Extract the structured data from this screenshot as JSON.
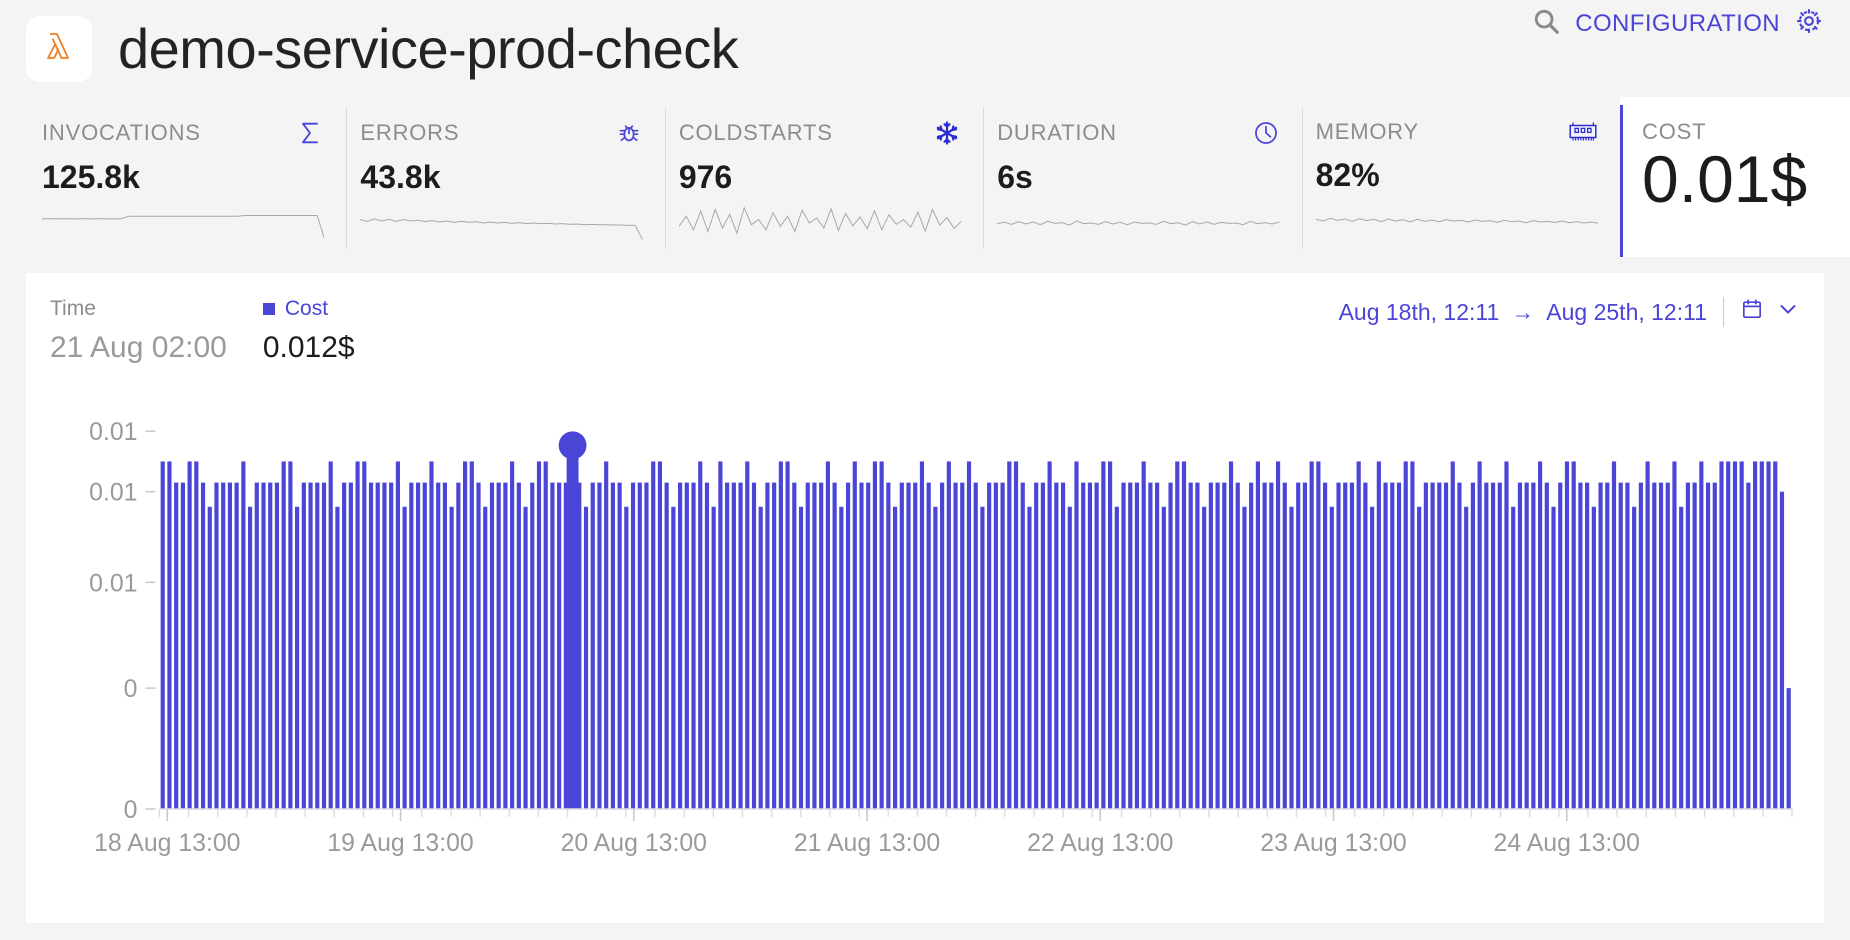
{
  "header": {
    "logo_icon": "aws-lambda-icon",
    "title": "demo-service-prod-check",
    "search_icon": "search-icon",
    "configuration_label": "CONFIGURATION",
    "gear_icon": "gear-icon",
    "accent_color": "#4a45d6",
    "logo_color": "#ef7d22"
  },
  "metrics": [
    {
      "label": "INVOCATIONS",
      "value": "125.8k",
      "icon": "sigma-icon"
    },
    {
      "label": "ERRORS",
      "value": "43.8k",
      "icon": "bug-icon"
    },
    {
      "label": "COLDSTARTS",
      "value": "976",
      "icon": "snowflake-icon"
    },
    {
      "label": "DURATION",
      "value": "6s",
      "icon": "clock-icon"
    },
    {
      "label": "MEMORY",
      "value": "82%",
      "icon": "memory-chip-icon"
    },
    {
      "label": "COST",
      "value": "0.01$",
      "icon": "",
      "selected": true
    }
  ],
  "chart_panel": {
    "tooltip": {
      "time_label": "Time",
      "time_value": "21 Aug 02:00",
      "series_label": "Cost",
      "series_value": "0.012$"
    },
    "date_range": {
      "start": "Aug 18th, 12:11",
      "arrow": "→",
      "end": "Aug 25th, 12:11",
      "calendar_icon": "calendar-icon",
      "chevron_icon": "chevron-down-icon"
    }
  },
  "chart_data": {
    "type": "bar",
    "title": "",
    "xlabel": "",
    "ylabel": "",
    "series_name": "Cost",
    "series_color": "#4a45d6",
    "grid": false,
    "legend_position": "top-left",
    "ytick_labels": [
      "0.01",
      "0.01",
      "0.01",
      "0",
      "0"
    ],
    "ytick_values": [
      0.0125,
      0.0105,
      0.0075,
      0.004,
      0.0
    ],
    "ylim": [
      0,
      0.0135
    ],
    "xtick_labels": [
      "18 Aug 13:00",
      "19 Aug 13:00",
      "20 Aug 13:00",
      "21 Aug 13:00",
      "22 Aug 13:00",
      "23 Aug 13:00",
      "24 Aug 13:00"
    ],
    "xlim_start": "Aug 18th, 12:11",
    "xlim_end": "Aug 25th, 12:11",
    "highlighted": {
      "x_label": "21 Aug 02:00",
      "value": 0.012,
      "index": 61
    },
    "values": [
      0.0115,
      0.0115,
      0.0108,
      0.0108,
      0.0115,
      0.0115,
      0.0108,
      0.01,
      0.0108,
      0.0108,
      0.0108,
      0.0108,
      0.0115,
      0.01,
      0.0108,
      0.0108,
      0.0108,
      0.0108,
      0.0115,
      0.0115,
      0.01,
      0.0108,
      0.0108,
      0.0108,
      0.0108,
      0.0115,
      0.01,
      0.0108,
      0.0108,
      0.0115,
      0.0115,
      0.0108,
      0.0108,
      0.0108,
      0.0108,
      0.0115,
      0.01,
      0.0108,
      0.0108,
      0.0108,
      0.0115,
      0.0108,
      0.0108,
      0.01,
      0.0108,
      0.0115,
      0.0115,
      0.0108,
      0.01,
      0.0108,
      0.0108,
      0.0108,
      0.0115,
      0.0108,
      0.01,
      0.0108,
      0.0115,
      0.0115,
      0.0108,
      0.0108,
      0.0108,
      0.012,
      0.0108,
      0.01,
      0.0108,
      0.0108,
      0.0115,
      0.0108,
      0.0108,
      0.01,
      0.0108,
      0.0108,
      0.0108,
      0.0115,
      0.0115,
      0.0108,
      0.01,
      0.0108,
      0.0108,
      0.0108,
      0.0115,
      0.0108,
      0.01,
      0.0115,
      0.0108,
      0.0108,
      0.0108,
      0.0115,
      0.0108,
      0.01,
      0.0108,
      0.0108,
      0.0115,
      0.0115,
      0.0108,
      0.01,
      0.0108,
      0.0108,
      0.0108,
      0.0115,
      0.0108,
      0.01,
      0.0108,
      0.0115,
      0.0108,
      0.0108,
      0.0115,
      0.0115,
      0.0108,
      0.01,
      0.0108,
      0.0108,
      0.0108,
      0.0115,
      0.0108,
      0.01,
      0.0108,
      0.0115,
      0.0108,
      0.0108,
      0.0115,
      0.0108,
      0.01,
      0.0108,
      0.0108,
      0.0108,
      0.0115,
      0.0115,
      0.0108,
      0.01,
      0.0108,
      0.0108,
      0.0115,
      0.0108,
      0.0108,
      0.01,
      0.0115,
      0.0108,
      0.0108,
      0.0108,
      0.0115,
      0.0115,
      0.01,
      0.0108,
      0.0108,
      0.0108,
      0.0115,
      0.0108,
      0.0108,
      0.01,
      0.0108,
      0.0115,
      0.0115,
      0.0108,
      0.0108,
      0.01,
      0.0108,
      0.0108,
      0.0108,
      0.0115,
      0.0108,
      0.01,
      0.0108,
      0.0115,
      0.0108,
      0.0108,
      0.0115,
      0.0108,
      0.01,
      0.0108,
      0.0108,
      0.0115,
      0.0115,
      0.0108,
      0.01,
      0.0108,
      0.0108,
      0.0108,
      0.0115,
      0.0108,
      0.01,
      0.0115,
      0.0108,
      0.0108,
      0.0108,
      0.0115,
      0.0115,
      0.01,
      0.0108,
      0.0108,
      0.0108,
      0.0108,
      0.0115,
      0.0108,
      0.01,
      0.0108,
      0.0115,
      0.0108,
      0.0108,
      0.0108,
      0.0115,
      0.01,
      0.0108,
      0.0108,
      0.0108,
      0.0115,
      0.0108,
      0.01,
      0.0108,
      0.0115,
      0.0115,
      0.0108,
      0.0108,
      0.01,
      0.0108,
      0.0108,
      0.0115,
      0.0108,
      0.0108,
      0.01,
      0.0108,
      0.0115,
      0.0108,
      0.0108,
      0.0108,
      0.0115,
      0.01,
      0.0108,
      0.0108,
      0.0115,
      0.0108,
      0.0108,
      0.0115,
      0.0115,
      0.0115,
      0.0115,
      0.0108,
      0.0115,
      0.0115,
      0.0115,
      0.0115,
      0.0105,
      0.004
    ],
    "sparklines": {
      "invocations": [
        0.62,
        0.63,
        0.62,
        0.63,
        0.62,
        0.62,
        0.63,
        0.62,
        0.63,
        0.62,
        0.62,
        0.63,
        0.7,
        0.7,
        0.7,
        0.7,
        0.7,
        0.7,
        0.7,
        0.7,
        0.7,
        0.7,
        0.7,
        0.7,
        0.7,
        0.7,
        0.7,
        0.7,
        0.72,
        0.72,
        0.72,
        0.72,
        0.72,
        0.72,
        0.72,
        0.72,
        0.72,
        0.72,
        0.72,
        0.05
      ],
      "errors": [
        0.6,
        0.55,
        0.62,
        0.56,
        0.61,
        0.55,
        0.6,
        0.56,
        0.58,
        0.54,
        0.57,
        0.53,
        0.56,
        0.52,
        0.55,
        0.52,
        0.54,
        0.5,
        0.53,
        0.5,
        0.52,
        0.49,
        0.51,
        0.48,
        0.5,
        0.48,
        0.49,
        0.47,
        0.48,
        0.46,
        0.47,
        0.45,
        0.46,
        0.45,
        0.45,
        0.44,
        0.44,
        0.43,
        0.43,
        0.02
      ],
      "coldstarts": [
        0.4,
        0.7,
        0.3,
        0.85,
        0.25,
        0.9,
        0.35,
        0.75,
        0.2,
        0.95,
        0.45,
        0.6,
        0.3,
        0.8,
        0.4,
        0.7,
        0.25,
        0.88,
        0.5,
        0.65,
        0.35,
        0.92,
        0.28,
        0.78,
        0.42,
        0.68,
        0.33,
        0.86,
        0.3,
        0.74,
        0.46,
        0.6,
        0.38,
        0.82,
        0.26,
        0.9,
        0.44,
        0.66,
        0.34,
        0.55
      ],
      "duration": [
        0.48,
        0.52,
        0.46,
        0.54,
        0.47,
        0.53,
        0.45,
        0.55,
        0.49,
        0.51,
        0.44,
        0.56,
        0.48,
        0.5,
        0.46,
        0.54,
        0.47,
        0.52,
        0.45,
        0.53,
        0.49,
        0.5,
        0.46,
        0.55,
        0.48,
        0.51,
        0.44,
        0.54,
        0.47,
        0.53,
        0.46,
        0.52,
        0.49,
        0.5,
        0.45,
        0.55,
        0.48,
        0.51,
        0.47,
        0.53
      ],
      "memory": [
        0.55,
        0.5,
        0.58,
        0.52,
        0.56,
        0.49,
        0.57,
        0.51,
        0.55,
        0.48,
        0.56,
        0.5,
        0.54,
        0.47,
        0.55,
        0.49,
        0.53,
        0.48,
        0.54,
        0.5,
        0.52,
        0.47,
        0.53,
        0.49,
        0.51,
        0.46,
        0.52,
        0.48,
        0.5,
        0.45,
        0.51,
        0.47,
        0.49,
        0.46,
        0.5,
        0.45,
        0.48,
        0.44,
        0.47,
        0.43
      ]
    }
  }
}
